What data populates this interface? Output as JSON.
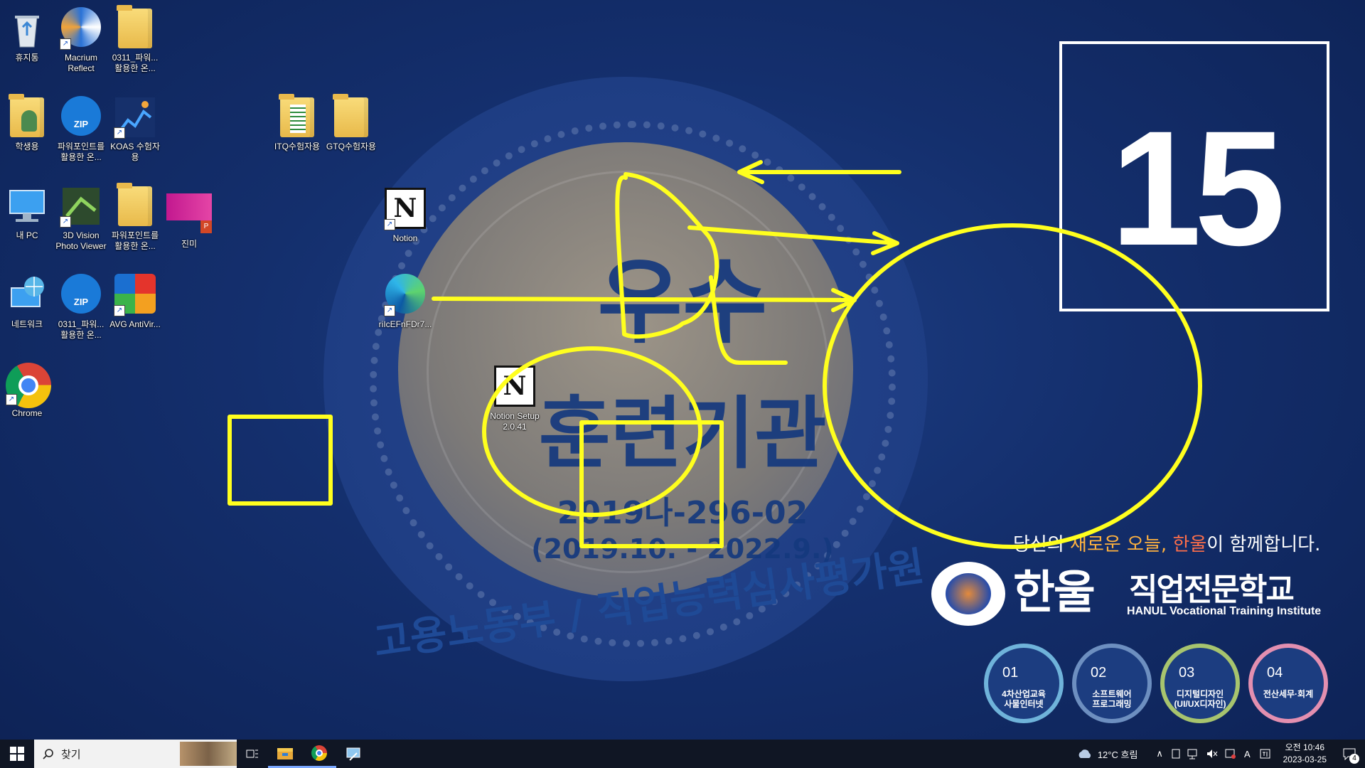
{
  "desktop_icons": [
    {
      "label": "휴지통",
      "icon": "recycle-bin-icon"
    },
    {
      "label": "Macrium Reflect",
      "icon": "macrium-icon"
    },
    {
      "label": "0311_파워... 활용한 온...",
      "icon": "folder-icon"
    },
    {
      "label": "학생용",
      "icon": "user-folder-icon"
    },
    {
      "label": "파워포인트를 활용한 온...",
      "icon": "zip-icon"
    },
    {
      "label": "KOAS 수험자용",
      "icon": "koas-icon"
    },
    {
      "label": "ITQ수험자용",
      "icon": "itq-folder-icon"
    },
    {
      "label": "GTQ수험자용",
      "icon": "folder-icon"
    },
    {
      "label": "내 PC",
      "icon": "pc-icon"
    },
    {
      "label": "3D Vision Photo Viewer",
      "icon": "3d-vision-icon"
    },
    {
      "label": "파워포인트를 활용한 온...",
      "icon": "folder-icon"
    },
    {
      "label": "진미",
      "icon": "pptx-file-icon"
    },
    {
      "label": "Notion",
      "icon": "notion-icon"
    },
    {
      "label": "네트워크",
      "icon": "network-icon"
    },
    {
      "label": "0311_파워... 활용한 온...",
      "icon": "zip-icon"
    },
    {
      "label": "AVG AntiVir...",
      "icon": "avg-icon"
    },
    {
      "label": "riIcEFnFDr7...",
      "icon": "edge-icon"
    },
    {
      "label": "Chrome",
      "icon": "chrome-icon"
    },
    {
      "label": "Notion Setup 2.0.41",
      "icon": "notion-icon"
    }
  ],
  "wallpaper": {
    "emblem_line1": "우수",
    "emblem_line2": "훈련기관",
    "emblem_code": "2019나-296-02",
    "emblem_period": "(2019.10. - 2022.9.)",
    "emblem_arc": "고용노동부 / 직업능력심사평가원",
    "number": "15",
    "slogan_pre": "당신의 ",
    "slogan_hl1": "새로운 오늘,",
    "slogan_mid": " ",
    "slogan_hl2": "한울",
    "slogan_post": "이 함께합니다.",
    "logo_main": "한울",
    "logo_sub": "직업전문학교",
    "logo_eng": "HANUL Vocational Training Institute",
    "courses": [
      {
        "num": "01",
        "line1": "4차산업교육",
        "line2": "사물인터넷",
        "color": "#6fb3da"
      },
      {
        "num": "02",
        "line1": "소프트웨어",
        "line2": "프로그래밍",
        "color": "#6d8fc0"
      },
      {
        "num": "03",
        "line1": "디지털디자인",
        "line2": "(UI/UX디자인)",
        "color": "#a7c46e"
      },
      {
        "num": "04",
        "line1": "전산세무·회계",
        "line2": "",
        "color": "#e38fb0"
      }
    ]
  },
  "taskbar": {
    "search_placeholder": "찾기",
    "weather": "12°C 흐림",
    "time": "오전 10:46",
    "date": "2023-03-25",
    "notification_count": "4",
    "ime": "A"
  },
  "colors": {
    "annotation": "#ffff1e",
    "taskbar": "#101624"
  }
}
